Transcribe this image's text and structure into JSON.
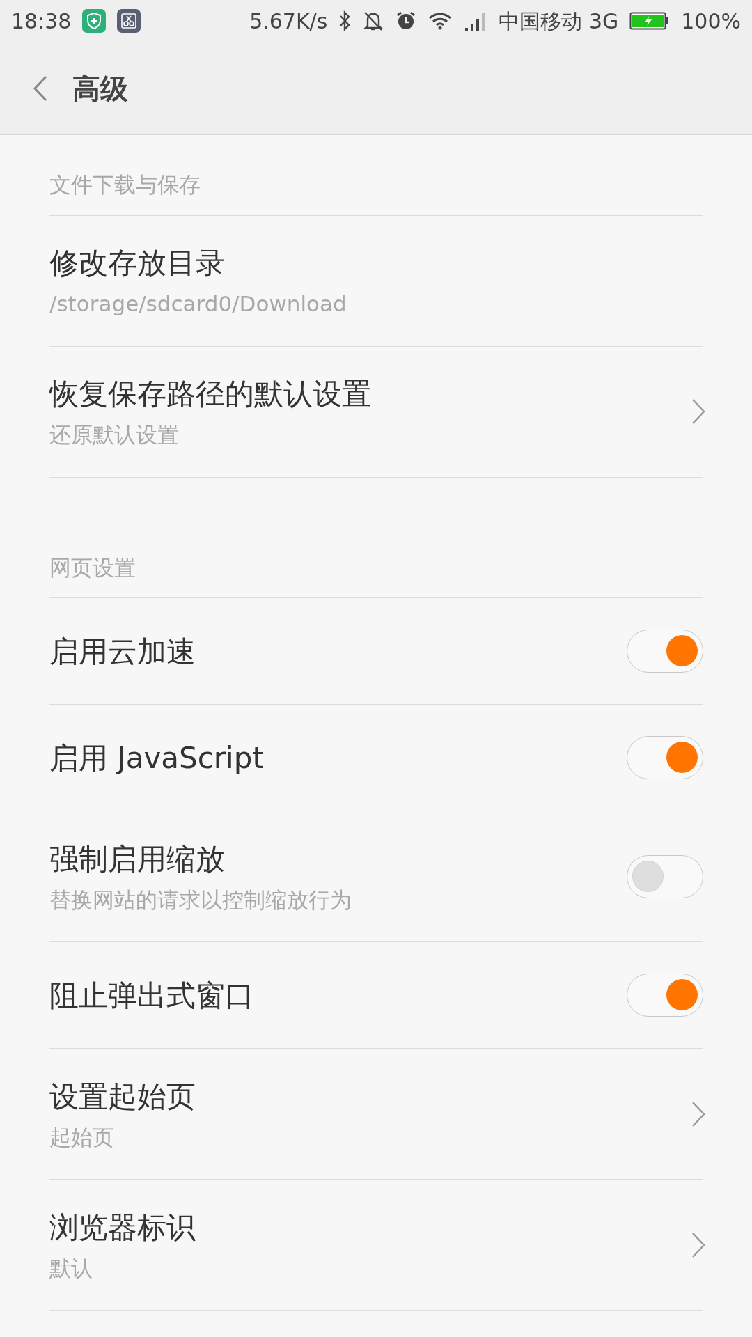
{
  "status_bar": {
    "time": "18:38",
    "speed": "5.67K/s",
    "carrier": "中国移动 3G",
    "battery": "100%"
  },
  "header": {
    "title": "高级"
  },
  "sections": [
    {
      "title": "文件下载与保存",
      "items": [
        {
          "kind": "text",
          "title": "修改存放目录",
          "subtitle": "/storage/sdcard0/Download"
        },
        {
          "kind": "link",
          "title": "恢复保存路径的默认设置",
          "subtitle": "还原默认设置"
        }
      ]
    },
    {
      "title": "网页设置",
      "items": [
        {
          "kind": "toggle",
          "title": "启用云加速",
          "on": true
        },
        {
          "kind": "toggle",
          "title": "启用 JavaScript",
          "on": true
        },
        {
          "kind": "toggle",
          "title": "强制启用缩放",
          "subtitle": "替换网站的请求以控制缩放行为",
          "on": false
        },
        {
          "kind": "toggle",
          "title": "阻止弹出式窗口",
          "on": true
        },
        {
          "kind": "link",
          "title": "设置起始页",
          "subtitle": "起始页"
        },
        {
          "kind": "link",
          "title": "浏览器标识",
          "subtitle": "默认"
        }
      ]
    }
  ]
}
